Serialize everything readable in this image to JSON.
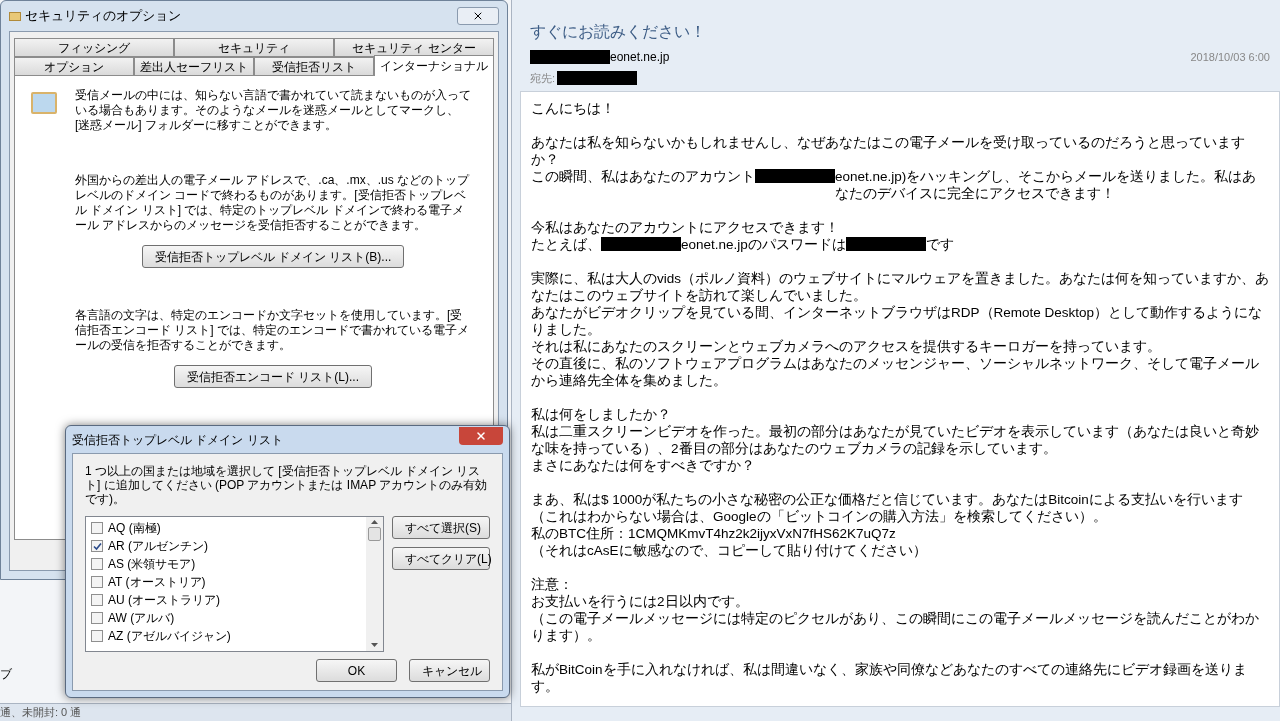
{
  "background": {
    "sidebar_text": "ブ",
    "status_text": "通、未開封: 0 通"
  },
  "security_window": {
    "title": "セキュリティのオプション",
    "tab_rows": [
      [
        {
          "label": "フィッシング",
          "selected": false
        },
        {
          "label": "セキュリティ",
          "selected": false
        },
        {
          "label": "セキュリティ センター",
          "selected": false
        }
      ],
      [
        {
          "label": "オプション",
          "selected": false
        },
        {
          "label": "差出人セーフリスト",
          "selected": false
        },
        {
          "label": "受信拒否リスト",
          "selected": false
        },
        {
          "label": "インターナショナル",
          "selected": true
        }
      ]
    ],
    "intro": "受信メールの中には、知らない言語で書かれていて読まないものが入っている場合もあります。そのようなメールを迷惑メールとしてマークし、[迷惑メール] フォルダーに移すことができます。",
    "sections": [
      {
        "text": "外国からの差出人の電子メール アドレスで、.ca、.mx、.us などのトップレベルのドメイン コードで終わるものがあります。[受信拒否トップレベル ドメイン リスト] では、特定のトップレベル ドメインで終わる電子メール アドレスからのメッセージを受信拒否することができます。",
        "button": "受信拒否トップレベル ドメイン リスト(B)..."
      },
      {
        "text": "各言語の文字は、特定のエンコードか文字セットを使用しています。[受信拒否エンコード リスト] では、特定のエンコードで書かれている電子メールの受信を拒否することができます。",
        "button": "受信拒否エンコード リスト(L)..."
      }
    ]
  },
  "domain_dialog": {
    "title": "受信拒否トップレベル ドメイン リスト",
    "instruction": "1 つ以上の国または地域を選択して [受信拒否トップレベル ドメイン リスト] に追加してください (POP アカウントまたは IMAP アカウントのみ有効です)。",
    "countries": [
      {
        "label": "AQ (南極)",
        "checked": false
      },
      {
        "label": "AR (アルゼンチン)",
        "checked": true
      },
      {
        "label": "AS (米領サモア)",
        "checked": false
      },
      {
        "label": "AT (オーストリア)",
        "checked": false
      },
      {
        "label": "AU (オーストラリア)",
        "checked": false
      },
      {
        "label": "AW (アルバ)",
        "checked": false
      },
      {
        "label": "AZ (アゼルバイジャン)",
        "checked": false
      }
    ],
    "side_buttons": [
      "すべて選択(S)",
      "すべてクリア(L)"
    ],
    "ok": "OK",
    "cancel": "キャンセル"
  },
  "email": {
    "subject": "すぐにお読みください！",
    "from": [
      {
        "kind": "redacted"
      },
      {
        "kind": "text",
        "text": "eonet.ne.jp"
      }
    ],
    "date": "2018/10/03 6:00",
    "to_label": "宛先:",
    "to": [
      {
        "kind": "redacted"
      }
    ],
    "body": [
      [
        [
          {
            "kind": "text",
            "text": "こんにちは！"
          }
        ]
      ],
      [
        [
          {
            "kind": "text",
            "text": "あなたは私を知らないかもしれませんし、なぜあなたはこの電子メールを受け取っているのだろうと思っていますか？"
          }
        ],
        [
          {
            "kind": "text",
            "text": "この瞬間、私はあなたのアカウント"
          },
          {
            "kind": "redacted"
          },
          {
            "kind": "text",
            "text": "eonet.ne.jp)をハッキングし、そこからメールを送りました。私はあなたのデバイスに完全にアクセスできます！"
          }
        ]
      ],
      [
        [
          {
            "kind": "text",
            "text": "今私はあなたのアカウントにアクセスできます！"
          }
        ],
        [
          {
            "kind": "text",
            "text": "たとえば、"
          },
          {
            "kind": "redacted"
          },
          {
            "kind": "text",
            "text": "eonet.ne.jpのパスワードは"
          },
          {
            "kind": "redacted"
          },
          {
            "kind": "text",
            "text": "です"
          }
        ]
      ],
      [
        [
          {
            "kind": "text",
            "text": "実際に、私は大人のvids（ポルノ資料）のウェブサイトにマルウェアを置きました。あなたは何を知っていますか、あなたはこのウェブサイトを訪れて楽しんでいました。"
          }
        ],
        [
          {
            "kind": "text",
            "text": "あなたがビデオクリップを見ている間、インターネットブラウザはRDP（Remote Desktop）として動作するようになりました。"
          }
        ],
        [
          {
            "kind": "text",
            "text": "それは私にあなたのスクリーンとウェブカメラへのアクセスを提供するキーロガーを持っています。"
          }
        ],
        [
          {
            "kind": "text",
            "text": "その直後に、私のソフトウェアプログラムはあなたのメッセンジャー、ソーシャルネットワーク、そして電子メールから連絡先全体を集めました。"
          }
        ]
      ],
      [
        [
          {
            "kind": "text",
            "text": "私は何をしましたか？"
          }
        ],
        [
          {
            "kind": "text",
            "text": "私は二重スクリーンビデオを作った。最初の部分はあなたが見ていたビデオを表示しています（あなたは良いと奇妙な味を持っている）、2番目の部分はあなたのウェブカメラの記録を示しています。"
          }
        ],
        [
          {
            "kind": "text",
            "text": "まさにあなたは何をすべきですか？"
          }
        ]
      ],
      [
        [
          {
            "kind": "text",
            "text": "まあ、私は$ 1000が私たちの小さな秘密の公正な価格だと信じています。あなたはBitcoinによる支払いを行います（これはわからない場合は、Googleの「ビットコインの購入方法」を検索してください）。"
          }
        ],
        [
          {
            "kind": "text",
            "text": "私のBTC住所：1CMQMKmvT4hz2k2ijyxVxN7fHS62K7uQ7z"
          }
        ],
        [
          {
            "kind": "text",
            "text": "（それはcAsEに敏感なので、コピーして貼り付けてください）"
          }
        ]
      ],
      [
        [
          {
            "kind": "text",
            "text": "注意："
          }
        ],
        [
          {
            "kind": "text",
            "text": "お支払いを行うには2日以内です。"
          }
        ],
        [
          {
            "kind": "text",
            "text": "（この電子メールメッセージには特定のピクセルがあり、この瞬間にこの電子メールメッセージを読んだことがわかります）。"
          }
        ]
      ],
      [
        [
          {
            "kind": "text",
            "text": "私がBitCoinを手に入れなければ、私は間違いなく、家族や同僚などあなたのすべての連絡先にビデオ録画を送ります。"
          }
        ]
      ]
    ]
  }
}
